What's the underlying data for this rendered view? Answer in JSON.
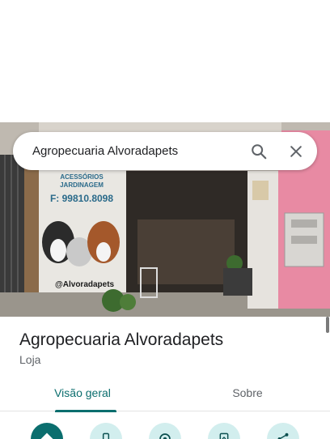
{
  "search": {
    "query": "Agropecuaria Alvoradapets"
  },
  "place": {
    "name": "Agropecuaria Alvoradapets",
    "category": "Loja"
  },
  "tabs": [
    {
      "label": "Visão geral",
      "active": true
    },
    {
      "label": "Sobre",
      "active": false
    }
  ],
  "photo_signage": {
    "line1": "ACESSÓRIOS",
    "line2": "JARDINAGEM",
    "phone": "F: 99810.8098",
    "handle": "@Alvoradapets"
  },
  "actions": [
    {
      "icon": "directions-icon"
    },
    {
      "icon": "phone-icon"
    },
    {
      "icon": "nearby-icon"
    },
    {
      "icon": "save-icon"
    },
    {
      "icon": "share-icon"
    }
  ],
  "colors": {
    "accent": "#0b6e6e",
    "action_bg": "#d2eeee",
    "primary_action": "#0b6e6e"
  }
}
